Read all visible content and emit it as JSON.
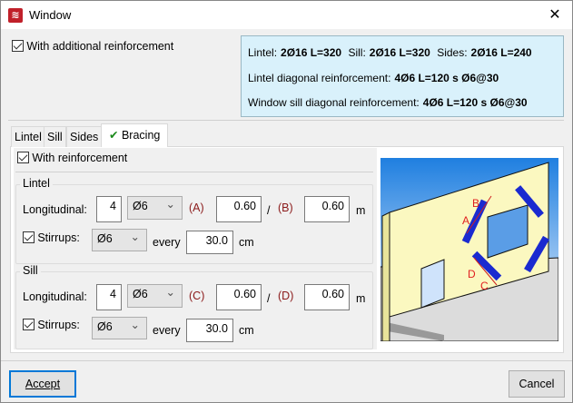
{
  "window": {
    "title": "Window",
    "icon": "app-logo-icon",
    "close_icon": "close-icon"
  },
  "additional": {
    "label": "With additional reinforcement",
    "checked": true
  },
  "summary": {
    "lintel_label": "Lintel:",
    "lintel_value": "2Ø16 L=320",
    "sill_label": "Sill:",
    "sill_value": "2Ø16 L=320",
    "sides_label": "Sides:",
    "sides_value": "2Ø16 L=240",
    "lintel_diag_label": "Lintel diagonal reinforcement:",
    "lintel_diag_value": "4Ø6 L=120 s Ø6@30",
    "sill_diag_label": "Window sill diagonal reinforcement:",
    "sill_diag_value": "4Ø6 L=120 s Ø6@30"
  },
  "tabs": [
    {
      "label": "Lintel"
    },
    {
      "label": "Sill"
    },
    {
      "label": "Sides"
    },
    {
      "label": "Bracing",
      "selected": true,
      "icon": "checkmark-icon"
    }
  ],
  "bracing": {
    "with_reinforcement": {
      "label": "With reinforcement",
      "checked": true
    },
    "lintel": {
      "title": "Lintel",
      "longitudinal_label": "Longitudinal:",
      "count": "4",
      "diameter": "Ø6",
      "a_label": "(A)",
      "a_value": "0.60",
      "slash": "/",
      "b_label": "(B)",
      "b_value": "0.60",
      "unit": "m",
      "stirrups_label": "Stirrups:",
      "stirrups_checked": true,
      "stirrups_diameter": "Ø6",
      "every_label": "every",
      "spacing": "30.0",
      "spacing_unit": "cm"
    },
    "sill": {
      "title": "Sill",
      "longitudinal_label": "Longitudinal:",
      "count": "4",
      "diameter": "Ø6",
      "c_label": "(C)",
      "c_value": "0.60",
      "slash": "/",
      "d_label": "(D)",
      "d_value": "0.60",
      "unit": "m",
      "stirrups_label": "Stirrups:",
      "stirrups_checked": true,
      "stirrups_diameter": "Ø6",
      "every_label": "every",
      "spacing": "30.0",
      "spacing_unit": "cm"
    },
    "diagram": {
      "labels": {
        "a": "A",
        "b": "B",
        "c": "C",
        "d": "D"
      }
    }
  },
  "buttons": {
    "accept": "Accept",
    "cancel": "Cancel"
  },
  "colors": {
    "accent": "#0078d7",
    "info_bg": "#d9f1fb",
    "label_red": "#8b1a1a",
    "wall": "#fbf8c0",
    "rebar": "#1a2ad0"
  }
}
